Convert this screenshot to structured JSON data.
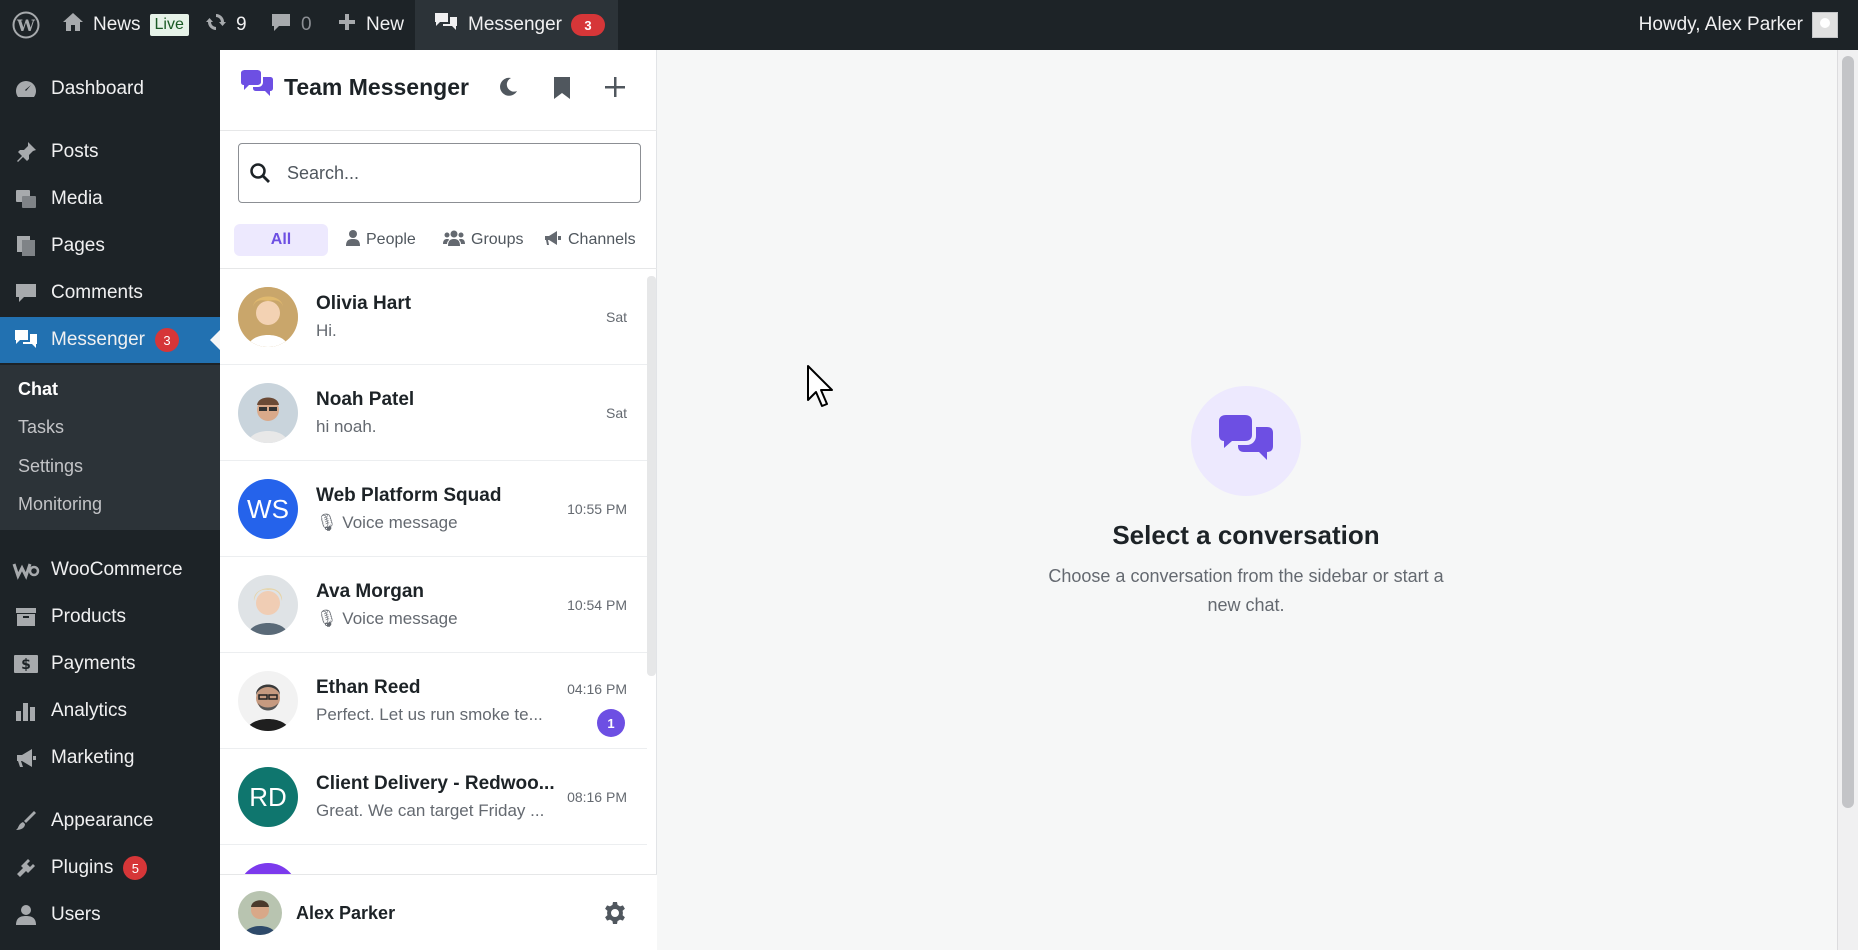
{
  "adminbar": {
    "site_name": "News",
    "live_label": "Live",
    "updates_count": "9",
    "comments_count": "0",
    "new_label": "New",
    "messenger_label": "Messenger",
    "messenger_count": "3",
    "howdy": "Howdy, Alex Parker"
  },
  "sidebar": {
    "items": [
      {
        "label": "Dashboard",
        "icon": "dashboard-icon"
      },
      {
        "label": "Posts",
        "icon": "pin-icon"
      },
      {
        "label": "Media",
        "icon": "media-icon"
      },
      {
        "label": "Pages",
        "icon": "pages-icon"
      },
      {
        "label": "Comments",
        "icon": "comment-icon"
      },
      {
        "label": "Messenger",
        "icon": "chat-bubbles-icon",
        "badge": "3"
      },
      {
        "label": "WooCommerce",
        "icon": "woo-icon"
      },
      {
        "label": "Products",
        "icon": "archive-icon"
      },
      {
        "label": "Payments",
        "icon": "dollar-icon"
      },
      {
        "label": "Analytics",
        "icon": "bar-chart-icon"
      },
      {
        "label": "Marketing",
        "icon": "megaphone-icon"
      },
      {
        "label": "Appearance",
        "icon": "brush-icon"
      },
      {
        "label": "Plugins",
        "icon": "plugin-icon",
        "badge": "5"
      },
      {
        "label": "Users",
        "icon": "user-icon"
      }
    ],
    "submenu": [
      "Chat",
      "Tasks",
      "Settings",
      "Monitoring"
    ]
  },
  "messenger": {
    "title": "Team Messenger",
    "search_placeholder": "Search...",
    "filters": [
      "All",
      "People",
      "Groups",
      "Channels"
    ],
    "conversations": [
      {
        "name": "Olivia Hart",
        "preview": "Hi.",
        "time": "Sat"
      },
      {
        "name": "Noah Patel",
        "preview": "hi noah.",
        "time": "Sat"
      },
      {
        "name": "Web Platform Squad",
        "initials": "WS",
        "preview": "🎙 Voice message",
        "time": "10:55 PM",
        "color": "#2563eb"
      },
      {
        "name": "Ava Morgan",
        "preview": "🎙 Voice message",
        "time": "10:54 PM"
      },
      {
        "name": "Ethan Reed",
        "preview": "Perfect. Let us run smoke te...",
        "time": "04:16 PM",
        "unread": "1"
      },
      {
        "name": "Client Delivery - Redwoo...",
        "initials": "RD",
        "preview": "Great. We can target Friday ...",
        "time": "08:16 PM",
        "color": "#0f766e"
      }
    ],
    "current_user": "Alex Parker"
  },
  "main": {
    "empty_title": "Select a conversation",
    "empty_subtitle": "Choose a conversation from the sidebar or start a new chat."
  },
  "colors": {
    "accent": "#6d4fe3",
    "wp_blue": "#2271b1",
    "badge_red": "#d63638",
    "admin_dark": "#1d2327"
  }
}
